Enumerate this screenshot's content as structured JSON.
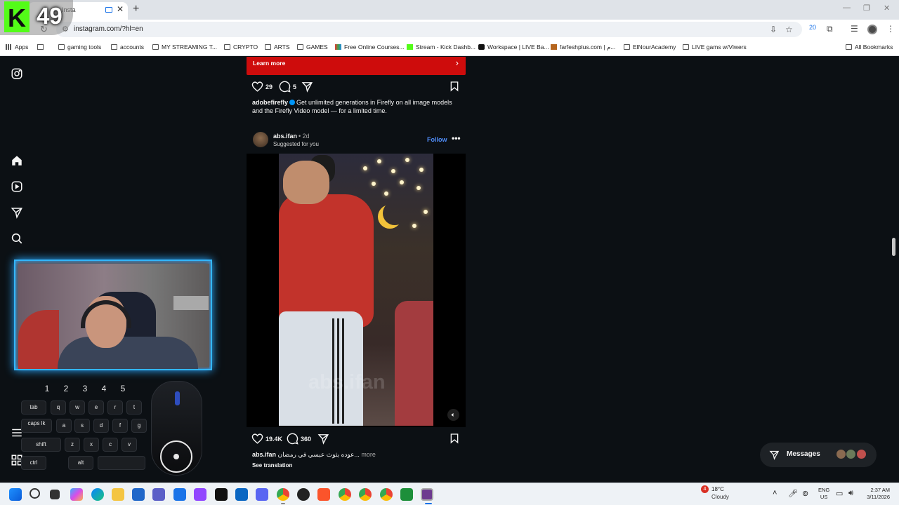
{
  "browser": {
    "tab_title": "Insta",
    "url": "instagram.com/?hl=en",
    "extension_badge": "20",
    "bookmarks": [
      {
        "label": "Apps",
        "icon": "apps-grid-icon"
      },
      {
        "label": "",
        "icon": "grid-icon"
      },
      {
        "label": "gaming tools",
        "icon": "folder-icon"
      },
      {
        "label": "accounts",
        "icon": "folder-icon"
      },
      {
        "label": "MY STREAMING T...",
        "icon": "folder-icon"
      },
      {
        "label": "CRYPTO",
        "icon": "folder-icon"
      },
      {
        "label": "ARTS",
        "icon": "folder-icon"
      },
      {
        "label": "GAMES",
        "icon": "folder-icon"
      },
      {
        "label": "Free Online Courses...",
        "icon": "site-icon"
      },
      {
        "label": "Stream - Kick Dashb...",
        "icon": "kick-icon"
      },
      {
        "label": "Workspace | LIVE Ba...",
        "icon": "tiktok-icon"
      },
      {
        "label": "farfeshplus.com | م...",
        "icon": "site-icon"
      },
      {
        "label": "ElNourAcademy",
        "icon": "folder-icon"
      },
      {
        "label": "LIVE gams w/Viwers",
        "icon": "folder-icon"
      }
    ],
    "all_bookmarks": "All Bookmarks"
  },
  "feed": {
    "ad": {
      "cta_label": "Learn more",
      "likes": "29",
      "comments": "5",
      "username": "adobefirefly",
      "caption": "Get unlimited generations in Firefly on all image models and the Firefly Video model — for a limited time."
    },
    "post": {
      "username": "abs.ifan",
      "time": "• 2d",
      "subtitle": "Suggested for you",
      "follow_label": "Follow",
      "watermark": "abs.ifan",
      "likes": "19.4K",
      "comments": "360",
      "caption_user": "abs.ifan",
      "caption_text": "عوده بثوث عبسي في رمضان...",
      "more_label": "more",
      "translation_label": "See translation"
    }
  },
  "messages": {
    "label": "Messages"
  },
  "overlay": {
    "kick_letter": "K",
    "viewer_count": "49",
    "number_keys": [
      "1",
      "2",
      "3",
      "4",
      "5"
    ],
    "keys": {
      "tab": "tab",
      "q": "q",
      "w": "w",
      "e": "e",
      "r": "r",
      "t": "t",
      "caps": "caps lk",
      "a": "a",
      "s": "s",
      "d": "d",
      "f": "f",
      "g": "g",
      "shift": "shift",
      "z": "z",
      "x": "x",
      "c": "c",
      "v": "v",
      "ctrl": "ctrl",
      "alt": "alt"
    }
  },
  "taskbar": {
    "weather_badge": "4",
    "temperature": "18°C",
    "weather": "Cloudy",
    "lang_1": "ENG",
    "lang_2": "US",
    "time": "2:37 AM",
    "date": "3/11/2026"
  },
  "colors": {
    "kick_green": "#53fc18",
    "instagram_bg": "#0c1014",
    "ad_red": "#ce0c0c",
    "follow_blue": "#4f8cf7",
    "webcam_glow": "#33b6ff"
  }
}
